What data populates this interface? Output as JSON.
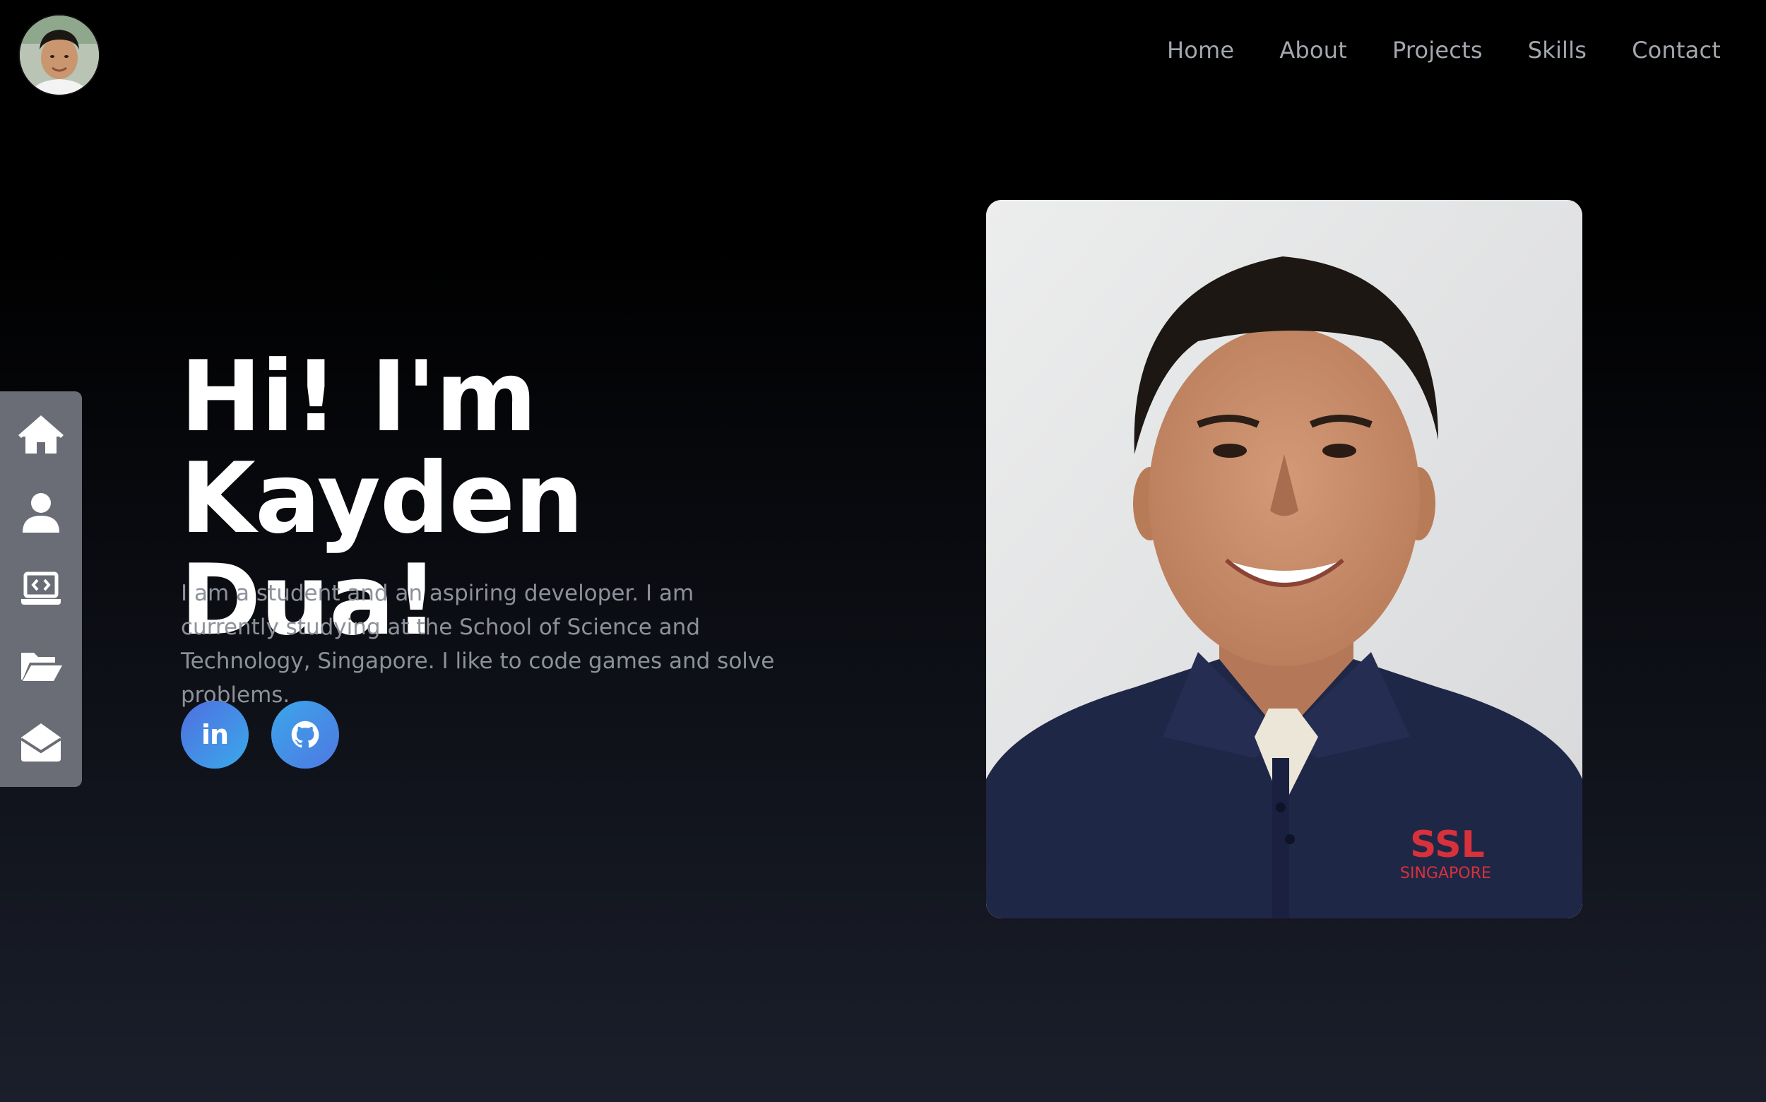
{
  "header": {
    "avatar": {
      "icon": "profile-photo"
    },
    "nav": [
      {
        "label": "Home"
      },
      {
        "label": "About"
      },
      {
        "label": "Projects"
      },
      {
        "label": "Skills"
      },
      {
        "label": "Contact"
      }
    ]
  },
  "dock": {
    "background": "#6a6d76",
    "items": [
      {
        "icon": "home-icon"
      },
      {
        "icon": "user-icon"
      },
      {
        "icon": "laptop-code-icon"
      },
      {
        "icon": "folder-open-icon"
      },
      {
        "icon": "envelope-open-icon"
      }
    ]
  },
  "hero": {
    "title_line1": "Hi! I'm Kayden",
    "title_line2": "Dua!",
    "description": "I am a student and an aspiring developer. I am currently studying at the School of Science and Technology, Singapore. I like to code games and solve problems.",
    "social": [
      {
        "icon": "linkedin-icon",
        "text": "in"
      },
      {
        "icon": "github-icon"
      }
    ],
    "accent_gradient": [
      "#4f6fe0",
      "#3aa9ea"
    ]
  },
  "portrait": {
    "shirt_logo_main": "SSL",
    "shirt_logo_sub": "SINGAPORE",
    "colors": {
      "shirt": "#1f2747",
      "wall": "#e5e6e8",
      "logo_red": "#d8313b"
    }
  }
}
